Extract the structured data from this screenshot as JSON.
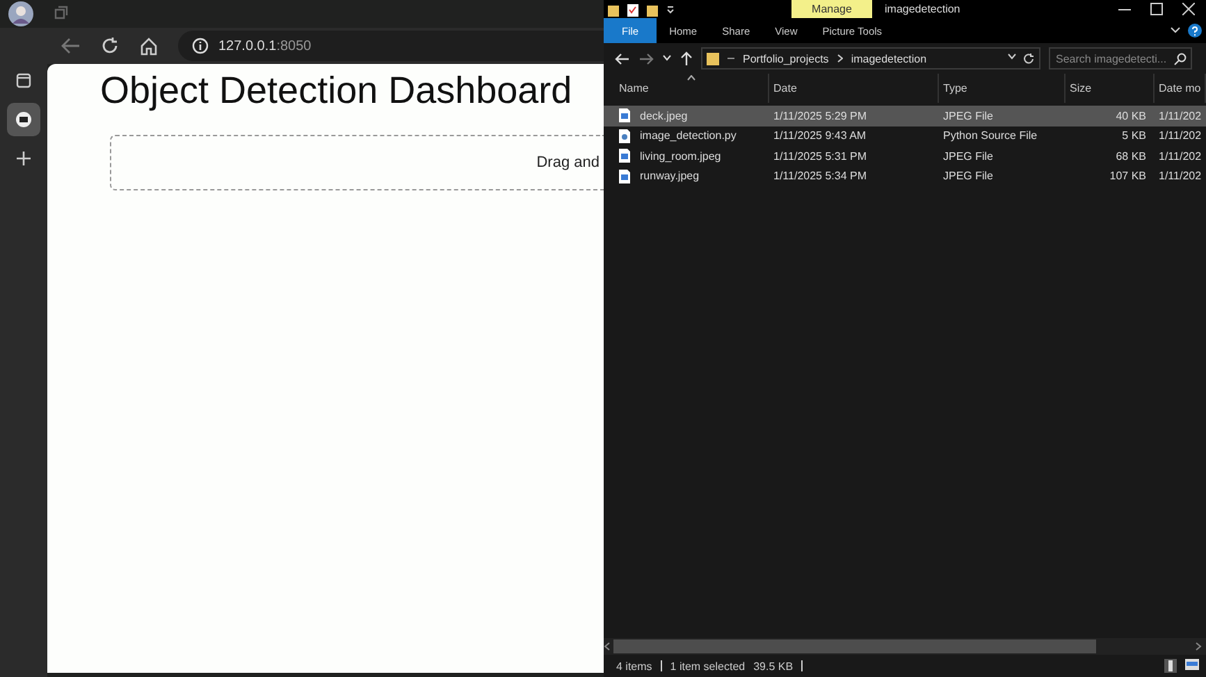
{
  "browser": {
    "url_host": "127.0.0.1",
    "url_port": ":8050",
    "tabs": [
      {
        "selected": true
      }
    ],
    "page": {
      "heading": "Object Detection Dashboard",
      "upload_text": "Drag and"
    }
  },
  "explorer": {
    "title": "imagedetection",
    "context_tab": "Manage",
    "ribbon_tabs": [
      {
        "label": "File",
        "selected": true
      },
      {
        "label": "Home",
        "selected": false
      },
      {
        "label": "Share",
        "selected": false
      },
      {
        "label": "View",
        "selected": false
      },
      {
        "label": "Picture Tools",
        "selected": false
      }
    ],
    "breadcrumbs": [
      "Portfolio_projects",
      "imagedetection"
    ],
    "search": {
      "placeholder": "Search imagedetecti..."
    },
    "columns": [
      "Name",
      "Date",
      "Type",
      "Size",
      "Date mo"
    ],
    "rows": [
      {
        "kind": "image",
        "name": "deck.jpeg",
        "date": "1/11/2025 5:29 PM",
        "type": "JPEG File",
        "size": "40 KB",
        "modified": "1/11/202",
        "selected": true
      },
      {
        "kind": "script",
        "name": "image_detection.py",
        "date": "1/11/2025 9:43 AM",
        "type": "Python Source File",
        "size": "5 KB",
        "modified": "1/11/202",
        "selected": false
      },
      {
        "kind": "image",
        "name": "living_room.jpeg",
        "date": "1/11/2025 5:31 PM",
        "type": "JPEG File",
        "size": "68 KB",
        "modified": "1/11/202",
        "selected": false
      },
      {
        "kind": "image",
        "name": "runway.jpeg",
        "date": "1/11/2025 5:34 PM",
        "type": "JPEG File",
        "size": "107 KB",
        "modified": "1/11/202",
        "selected": false
      }
    ],
    "status": [
      "4 items",
      "1 item selected",
      "39.5 KB"
    ]
  }
}
